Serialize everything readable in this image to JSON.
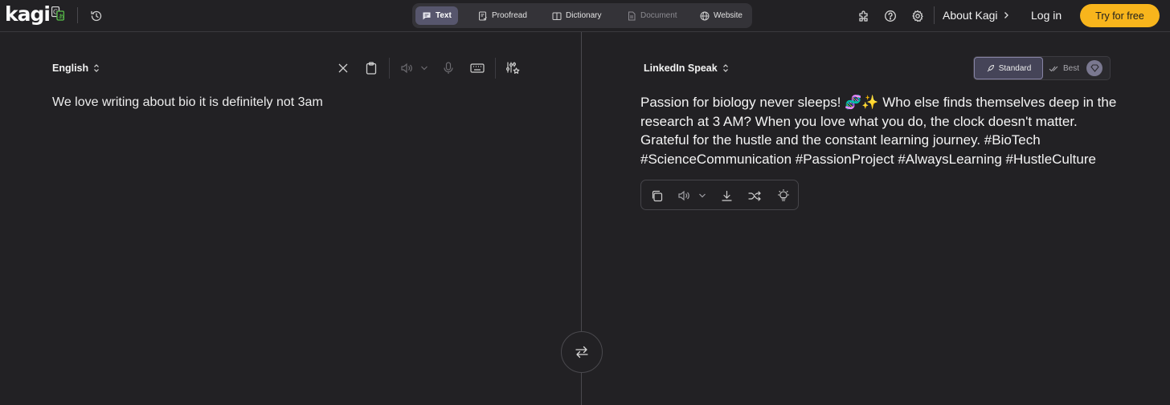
{
  "app": {
    "logo_text": "kagi"
  },
  "tabs": [
    {
      "label": "Text",
      "icon": "chat-bubble-icon",
      "active": true
    },
    {
      "label": "Proofread",
      "icon": "proofread-icon",
      "active": false
    },
    {
      "label": "Dictionary",
      "icon": "book-icon",
      "active": false
    },
    {
      "label": "Document",
      "icon": "document-icon",
      "active": false,
      "disabled": true
    },
    {
      "label": "Website",
      "icon": "globe-icon",
      "active": false
    }
  ],
  "nav": {
    "about": "About Kagi",
    "login": "Log in",
    "try": "Try for free"
  },
  "source": {
    "language": "English",
    "text": "We love writing about bio it is definitely not 3am"
  },
  "target": {
    "language": "LinkedIn Speak",
    "text": "Passion for biology never sleeps! 🧬✨ Who else finds themselves deep in the research at 3 AM? When you love what you do, the clock doesn't matter. Grateful for the hustle and the constant learning journey. #BioTech #ScienceCommunication #PassionProject #AlwaysLearning #HustleCulture",
    "modes": {
      "standard": "Standard",
      "best": "Best",
      "selected": "Standard"
    }
  },
  "colors": {
    "background": "#222124",
    "accent": "#f8b51c",
    "tab_active": "#57566d"
  }
}
